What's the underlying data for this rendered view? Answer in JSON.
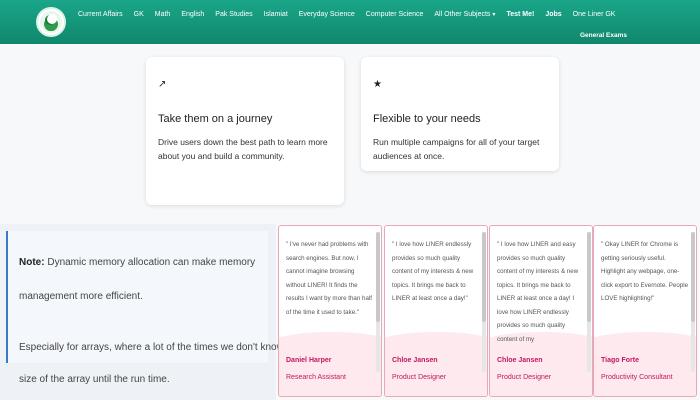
{
  "nav": {
    "items": [
      {
        "label": "Current Affairs",
        "bold": false
      },
      {
        "label": "GK",
        "bold": false
      },
      {
        "label": "Math",
        "bold": false
      },
      {
        "label": "English",
        "bold": false
      },
      {
        "label": "Pak Studies",
        "bold": false
      },
      {
        "label": "Islamiat",
        "bold": false
      },
      {
        "label": "Everyday Science",
        "bold": false
      },
      {
        "label": "Computer Science",
        "bold": false
      },
      {
        "label": "All Other Subjects",
        "bold": false,
        "caret": true
      },
      {
        "label": "Test Me!",
        "bold": true
      },
      {
        "label": "Jobs",
        "bold": true
      },
      {
        "label": "One Liner GK",
        "bold": false
      }
    ],
    "extra": "General Exams",
    "logo_icon": "crescent-logo-icon"
  },
  "features": [
    {
      "icon": "trend-icon",
      "glyph": "↗",
      "title": "Take them on a journey",
      "desc": "Drive users down the best path to learn more about you and build a community."
    },
    {
      "icon": "star-icon",
      "glyph": "★",
      "title": "Flexible to your needs",
      "desc": "Run multiple campaigns for all of your target audiences at once."
    }
  ],
  "note": {
    "label": "Note:",
    "line1_rest": " Dynamic memory allocation can make memory",
    "line2": "management more efficient.",
    "line3": "Especially for arrays, where a lot of the times we don't know the",
    "line4": "size of the array until the run time."
  },
  "testimonials": [
    {
      "quote": "\" I've never had problems with search engines. But now, I cannot imagine browsing without LINER! It finds the results I want by more than half of the time it used to take.\"",
      "name": "Daniel Harper",
      "role": "Research Assistant"
    },
    {
      "quote": "\" I love how LINER endlessly provides so much quality content of my interests & new topics. It brings me back to LINER at least once a day!\"",
      "name": "Chloe Jansen",
      "role": "Product Designer"
    },
    {
      "quote": "\" I love how LINER and easy provides so much quality content of my interests & new topics. It brings me back to LINER at least once a day! I love how LINER endlessly provides so much quality content of my",
      "name": "Chloe Jansen",
      "role": "Product Designer"
    },
    {
      "quote": "\" Okay LINER for Chrome is getting seriously useful. Highlight any webpage, one-click export to Evernote. People LOVE highlighting!\"",
      "name": "Tiago Forte",
      "role": "Productivity Consultant"
    }
  ],
  "colors": {
    "nav": "#10876c",
    "accent": "#c2185b",
    "note_border": "#3a78c8"
  }
}
